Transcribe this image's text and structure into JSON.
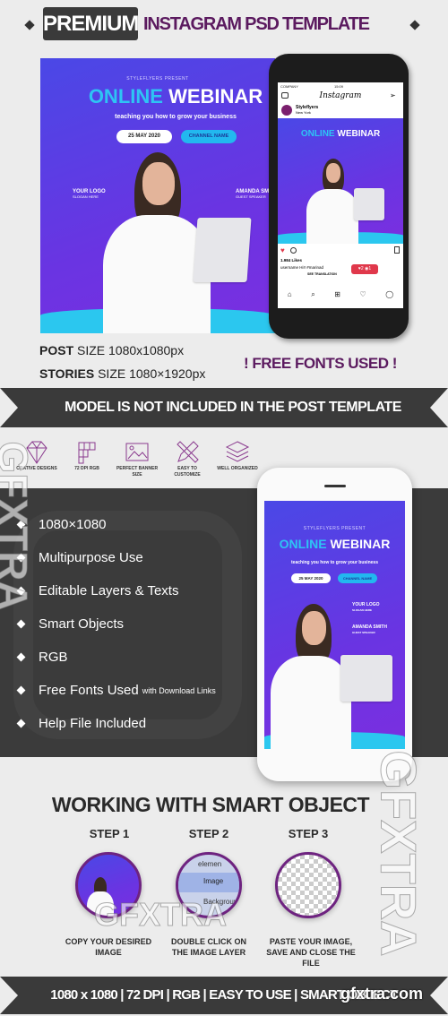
{
  "header": {
    "badge": "PREMIUM",
    "title": "INSTAGRAM  PSD TEMPLATE"
  },
  "post": {
    "presenter": "STYLEFLYERS PRESENT",
    "headline_accent": "ONLINE",
    "headline_main": "WEBINAR",
    "subtitle": "teaching you how to grow your business",
    "date": "25 MAY 2020",
    "channel": "CHANNEL NAME",
    "logo": "YOUR LOGO",
    "slogan": "SLOGAN HERE",
    "speaker": "AMANDA SMITH",
    "speaker_role": "GUEST SPEAKER"
  },
  "instagram": {
    "carrier": "COMPANY",
    "time": "15:09",
    "app_name": "Instagram",
    "account": "Styleflyers",
    "location": "New York",
    "likes": "1.984 Likes",
    "caption": "username Hi!! #marinad",
    "see_translation": "SEE TRANSLATION",
    "notif_likes": "2",
    "notif_follows": "1"
  },
  "sizes": {
    "post_bold": "POST",
    "post_rest": "SIZE 1080x1080px",
    "stories_bold": "STORIES",
    "stories_rest": "SIZE 1080×1920px"
  },
  "free_fonts": "! FREE FONTS USED !",
  "ribbon_top": "MODEL IS NOT INCLUDED  IN THE POST TEMPLATE",
  "features": [
    {
      "icon": "diamond-icon",
      "label": "CRATIVE DESIGNS"
    },
    {
      "icon": "grid-icon",
      "label": "72 DPI RGB"
    },
    {
      "icon": "image-icon",
      "label": "PERFECT BANNER SIZE"
    },
    {
      "icon": "pencil-ruler-icon",
      "label": "EASY TO CUSTOMIZE"
    },
    {
      "icon": "layers-icon",
      "label": "WELL ORGANIZED"
    }
  ],
  "list": [
    {
      "text": "1080×1080"
    },
    {
      "text": "Multipurpose Use"
    },
    {
      "text": "Editable Layers & Texts"
    },
    {
      "text": "Smart Objects"
    },
    {
      "text": "RGB"
    },
    {
      "text": "Free Fonts Used",
      "note": "with Download Links"
    },
    {
      "text": "Help File Included"
    }
  ],
  "smart": {
    "title": "WORKING WITH SMART OBJECT",
    "steps": [
      {
        "title": "STEP 1",
        "caption": "COPY YOUR DESIRED IMAGE"
      },
      {
        "title": "STEP 2",
        "caption": "DOUBLE CLICK ON THE IMAGE LAYER",
        "layers": [
          "elemen",
          "Image",
          "Backgroun"
        ]
      },
      {
        "title": "STEP 3",
        "caption": "PASTE YOUR IMAGE, SAVE AND CLOSE THE FILE"
      }
    ]
  },
  "ribbon_bottom": "1080 x 1080  |  72 DPI  |  RGB  |  EASY TO USE  |  SMART OBJECT",
  "watermarks": {
    "side": "GFXTRA",
    "center": "GFXTRA",
    "url": "gfxtra.com"
  },
  "colors": {
    "purple": "#5b1a5f",
    "dark": "#3a3a3a",
    "post_bg": "#5a3de3",
    "cyan": "#2bc7ef"
  }
}
